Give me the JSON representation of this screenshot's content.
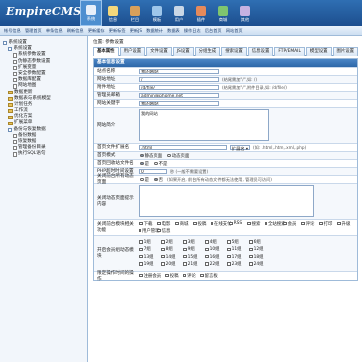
{
  "header": {
    "logo": "EmpireCMS",
    "nav": [
      {
        "label": "系统",
        "color": "#e7f0fa",
        "on": true
      },
      {
        "label": "信息",
        "color": "#f3d77b"
      },
      {
        "label": "栏目",
        "color": "#d9a05a"
      },
      {
        "label": "模板",
        "color": "#9ec6ea"
      },
      {
        "label": "用户",
        "color": "#c9d7e6"
      },
      {
        "label": "插件",
        "color": "#e58a5b"
      },
      {
        "label": "商城",
        "color": "#7fc56f"
      },
      {
        "label": "其他",
        "color": "#c7b2e2"
      }
    ]
  },
  "subnav": [
    "帐号信息",
    "管理首页",
    "单条信息",
    "刷新信息",
    "更新缓存",
    "更新标签",
    "更新JS",
    "数据统计",
    "数据表",
    "操作日志",
    "后台首页",
    "网站首页"
  ],
  "sidebar": {
    "items": [
      {
        "label": "系统设置",
        "indent": 0,
        "kind": "ic"
      },
      {
        "label": "系统设置",
        "indent": 1,
        "kind": "ic"
      },
      {
        "label": "系统参数设置",
        "indent": 2,
        "kind": "doc"
      },
      {
        "label": "伪静态参数设置",
        "indent": 2,
        "kind": "doc"
      },
      {
        "label": "扩展变量",
        "indent": 2,
        "kind": "doc"
      },
      {
        "label": "安全参数配置",
        "indent": 2,
        "kind": "doc"
      },
      {
        "label": "数据库配置",
        "indent": 2,
        "kind": "doc"
      },
      {
        "label": "网站地图",
        "indent": 2,
        "kind": "doc"
      },
      {
        "label": "数据更新",
        "indent": 1,
        "kind": "fd"
      },
      {
        "label": "数据表与系统模型",
        "indent": 1,
        "kind": "fd"
      },
      {
        "label": "计划任务",
        "indent": 1,
        "kind": "fd"
      },
      {
        "label": "工作流",
        "indent": 1,
        "kind": "fd"
      },
      {
        "label": "优化方案",
        "indent": 1,
        "kind": "fd"
      },
      {
        "label": "扩展菜单",
        "indent": 1,
        "kind": "fd"
      },
      {
        "label": "备份与恢复数据",
        "indent": 1,
        "kind": "ic"
      },
      {
        "label": "备份数据",
        "indent": 2,
        "kind": "doc"
      },
      {
        "label": "恢复数据",
        "indent": 2,
        "kind": "doc"
      },
      {
        "label": "管理备份目录",
        "indent": 2,
        "kind": "doc"
      },
      {
        "label": "执行SQL语句",
        "indent": 2,
        "kind": "doc"
      }
    ]
  },
  "main": {
    "breadcrumb": "位置: 参数设置",
    "tabs": [
      "基本属性",
      "用户设置",
      "文件设置",
      "JS设置",
      "分组生成",
      "搜索设置",
      "信息设置",
      "FTP/EMAIL",
      "模型设置",
      "图片设置"
    ],
    "form_title": "基本信息设置",
    "fields": {
      "site_name_label": "站点名称",
      "site_name": "我的网站",
      "site_url_label": "网站地址",
      "site_url": "/",
      "site_url_hint": "(结尾需加\"/\",如: /)",
      "attach_label": "附件地址",
      "attach": "/d/file/",
      "attach_hint": "(结尾需加\"/\",附件目录,如: /d/file/)",
      "email_label": "管理员邮箱",
      "email": "admin@phome.net",
      "keywords_label": "网站关键字",
      "keywords": "我的网站",
      "desc_label": "网站简介",
      "desc": "我的网站",
      "index_ext_label": "首页文件扩展名",
      "index_ext": ".html",
      "ext_select": "扩展名",
      "index_ext_hint": "(如: .html,.htm,.xml,.php)",
      "index_mode_label": "首页模式",
      "index_mode_opt1": "静态页面",
      "index_mode_opt2": "动态页面",
      "index_opt_label": "首页回收站文件名",
      "opt_yes": "是",
      "opt_no": "不是",
      "php_time_label": "PHP超时时间设置",
      "php_time": "0",
      "php_time_hint": "秒 (一般不需要设置)",
      "close_label": "关闭前台所有动态页面",
      "close_opt1": "是",
      "close_opt2": "否",
      "close_hint": "(如果开启, 前台所有动态文件都无法使用, 管理员可访问)",
      "close_tip_label": "关闭动态页面提示内容",
      "module_label": "关闭前台模块相关功能",
      "modules": [
        "下载",
        "电影",
        "商城",
        "投稿",
        "在线支付",
        "RSS",
        "搜索",
        "全站搜索",
        "会员",
        "评论",
        "打印",
        "升级",
        "用户管理",
        "信息"
      ],
      "group_label": "开启会员组动态模块",
      "groups": [
        "1组",
        "2组",
        "3组",
        "4组",
        "5组",
        "6组",
        "7组",
        "8组",
        "9组",
        "10组",
        "11组",
        "12组",
        "13组",
        "14组",
        "15组",
        "16组",
        "17组",
        "18组",
        "19组",
        "20组",
        "21组",
        "22组",
        "23组",
        "24组"
      ],
      "operate_label": "限定操作时间的操作",
      "operate_opts": [
        "注册会员",
        "投稿",
        "评论",
        "留言板"
      ]
    }
  }
}
